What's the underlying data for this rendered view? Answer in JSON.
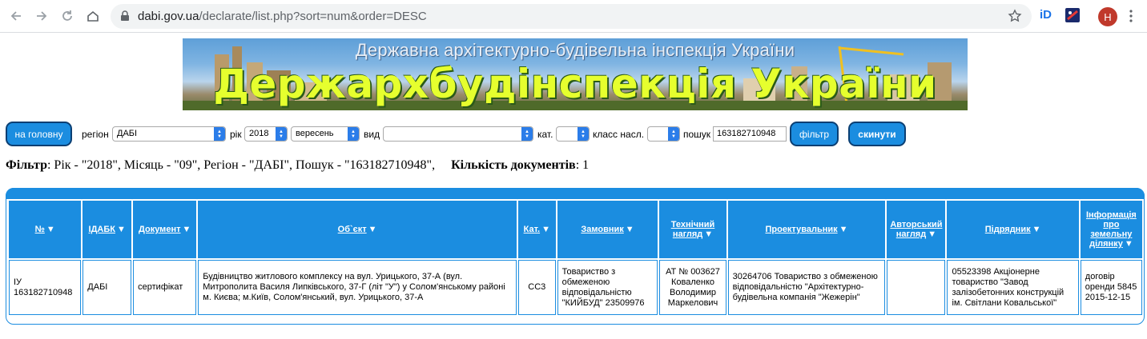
{
  "browser": {
    "url_domain": "dabi.gov.ua",
    "url_path": "/declarate/list.php?sort=num&order=DESC",
    "avatar_letter": "Н",
    "ext1_label": "iD"
  },
  "banner": {
    "subtitle": "Державна архітектурно-будівельна інспекція України",
    "title": "Держархбудінспекція України"
  },
  "filter": {
    "home_button": "на головну",
    "region_label": "регіон",
    "region_value": "ДАБІ",
    "year_label": "рік",
    "year_value": "2018",
    "month_value": "вересень",
    "type_label": "вид",
    "type_value": "",
    "cat_label": "кат.",
    "cat_value": "",
    "class_label": "класс насл.",
    "class_value": "",
    "search_label": "пошук",
    "search_value": "163182710948",
    "filter_button": "фільтр",
    "reset_button": "скинути"
  },
  "summary": {
    "filter_title": "Фільтр",
    "filter_text": ": Рік - \"2018\", Місяць - \"09\", Регіон - \"ДАБІ\", Пошук - \"163182710948\",",
    "count_title": "Кількість документів",
    "count_text": ": 1"
  },
  "table": {
    "columns": [
      "№",
      "ІДАБК",
      "Документ",
      "Об`єкт",
      "Кат.",
      "Замовник",
      "Технічний нагляд",
      "Проектувальник",
      "Авторський нагляд",
      "Підрядник",
      "Інформація про земельну ділянку"
    ],
    "rows": [
      [
        "ІУ 163182710948",
        "ДАБІ",
        "сертифікат",
        "Будівництво житлового комплексу на вул. Урицького, 37-А (вул. Митрополита Василя Липківського, 37-Г (літ \"У\") у Солом'янському районі м. Києва; м.Київ, Солом'янський, вул. Урицького, 37-А",
        "СС3",
        "Товариство з обмеженою відповідальністю \"КИЙБУД\" 23509976",
        "АТ № 003627 Коваленко Володимир Маркелович",
        "30264706 Товариство з обмеженою відповідальністю \"Архітектурно-будівельна компанія \"Жежерін\"",
        "",
        "05523398 Акціонерне товариство \"Завод залізобетонних конструкцій ім. Світлани Ковальської\"",
        "договір оренди 5845 2015-12-15"
      ]
    ]
  },
  "colors": {
    "accent": "#1b8de0",
    "accent_dark": "#0b3f73",
    "banner_title": "#e6ff2e"
  }
}
